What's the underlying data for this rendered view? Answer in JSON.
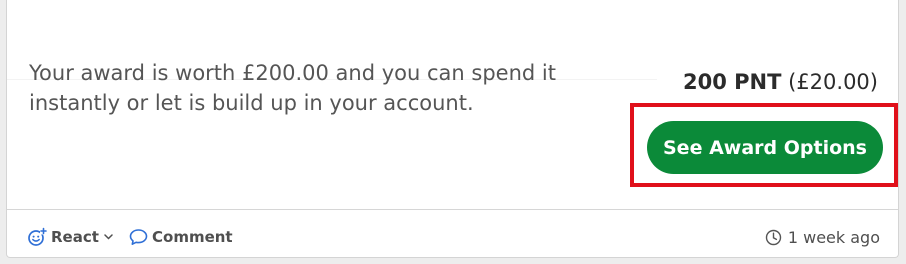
{
  "award": {
    "description": "Your award is worth £200.00 and you can spend it instantly or let is build up in your account.",
    "points": "200 PNT",
    "cash_value": "(£20.00)",
    "button_label": "See Award Options"
  },
  "footer": {
    "react_label": "React",
    "comment_label": "Comment",
    "timestamp": "1 week ago"
  },
  "colors": {
    "button_bg": "#0b8a39",
    "highlight_border": "#e0101a",
    "icon_blue": "#2f6fd6"
  },
  "icons": {
    "react": "smiley-plus-icon",
    "react_dropdown": "chevron-down-icon",
    "comment": "speech-bubble-icon",
    "timestamp": "clock-icon"
  }
}
